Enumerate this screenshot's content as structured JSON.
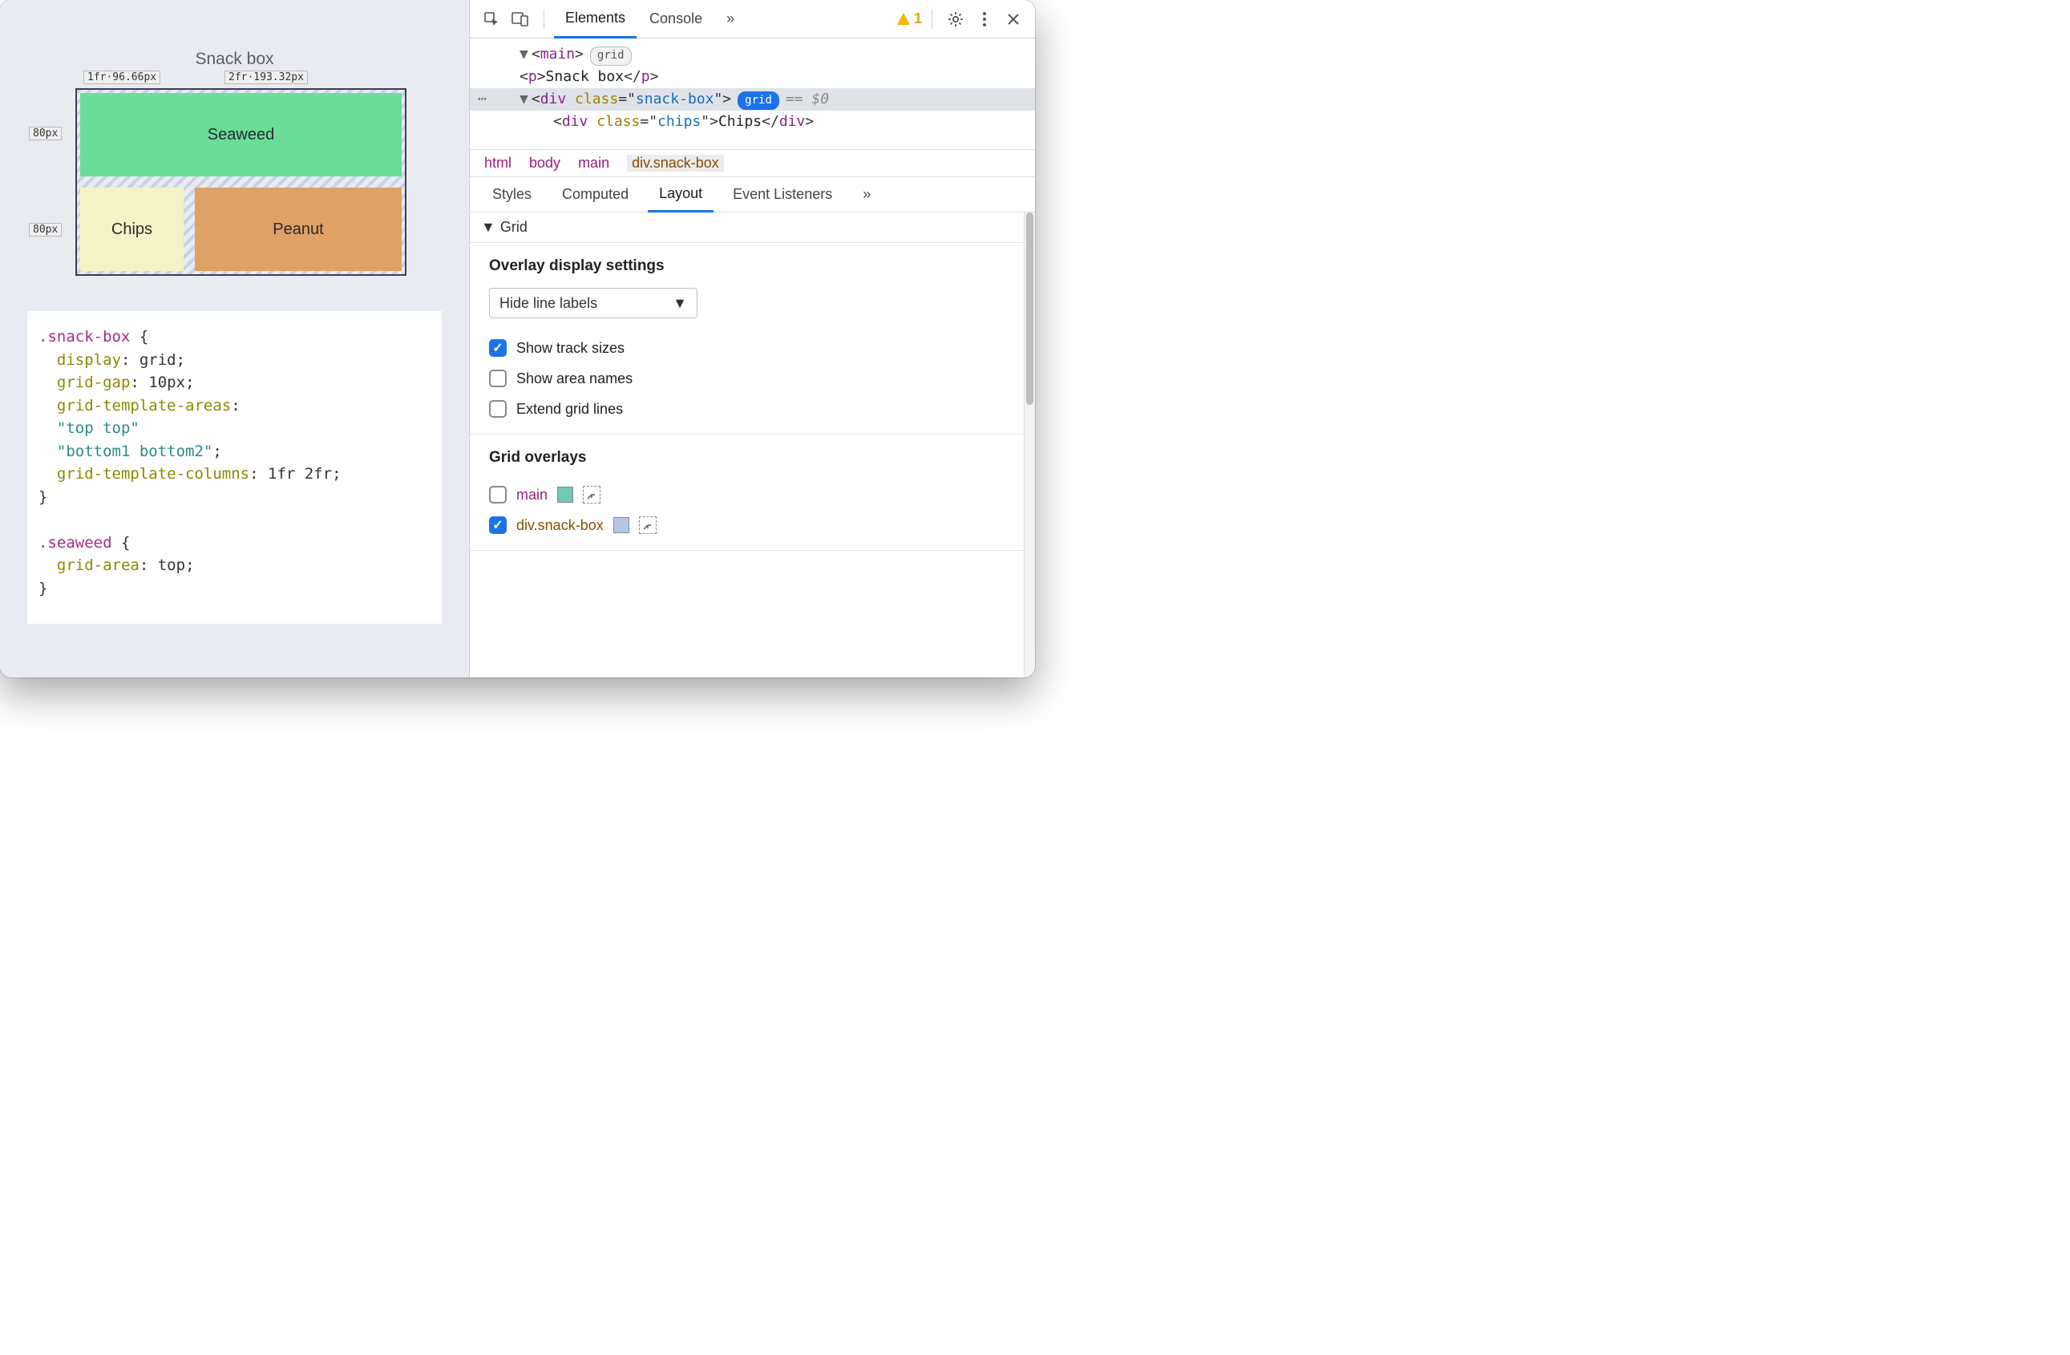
{
  "page": {
    "title": "Snack box",
    "grid": {
      "cells": {
        "seaweed": "Seaweed",
        "chips": "Chips",
        "peanut": "Peanut"
      },
      "measurements": {
        "top_col1": "1fr·96.66px",
        "top_col2": "2fr·193.32px",
        "left_row1": "80px",
        "left_row2": "80px"
      }
    },
    "css_code": {
      "rule1_selector": ".snack-box",
      "rule1_decls": [
        {
          "prop": "display",
          "val": "grid",
          "type": "kw"
        },
        {
          "prop": "grid-gap",
          "val": "10px",
          "type": "kw"
        },
        {
          "prop": "grid-template-areas",
          "val": [
            "\"top top\"",
            "\"bottom1 bottom2\""
          ],
          "type": "strlist"
        },
        {
          "prop": "grid-template-columns",
          "val": "1fr 2fr",
          "type": "kw"
        }
      ],
      "rule2_selector": ".seaweed",
      "rule2_decls": [
        {
          "prop": "grid-area",
          "val": "top",
          "type": "kw"
        }
      ]
    }
  },
  "devtools": {
    "toolbar": {
      "inspect_icon": "inspect",
      "device_icon": "device",
      "tabs": [
        "Elements",
        "Console"
      ],
      "active_tab": "Elements",
      "overflow": "»",
      "warning_count": "1",
      "settings_icon": "gear",
      "menu_icon": "kebab",
      "close_icon": "close"
    },
    "dom": {
      "rows": [
        {
          "depth": 0,
          "open": true,
          "tag": "main",
          "pill": "grid",
          "pill_blue": false
        },
        {
          "depth": 1,
          "tag": "p",
          "text": "Snack box",
          "close": "p"
        },
        {
          "depth": 1,
          "open": true,
          "tag": "div",
          "class": "snack-box",
          "pill": "grid",
          "pill_blue": true,
          "selected": true,
          "suffix": "== $0"
        },
        {
          "depth": 2,
          "tag": "div",
          "class": "chips",
          "text": "Chips",
          "close": "div"
        }
      ]
    },
    "breadcrumb": [
      "html",
      "body",
      "main",
      "div.snack-box"
    ],
    "subtabs": {
      "items": [
        "Styles",
        "Computed",
        "Layout",
        "Event Listeners"
      ],
      "active": "Layout",
      "overflow": "»"
    },
    "layout_panel": {
      "grid_section_label": "Grid",
      "overlay_settings": {
        "heading": "Overlay display settings",
        "select_value": "Hide line labels",
        "options": [
          {
            "label": "Show track sizes",
            "checked": true
          },
          {
            "label": "Show area names",
            "checked": false
          },
          {
            "label": "Extend grid lines",
            "checked": false
          }
        ]
      },
      "grid_overlays": {
        "heading": "Grid overlays",
        "items": [
          {
            "label": "main",
            "checked": false,
            "color": "#6fc9b3"
          },
          {
            "label": "div.snack-box",
            "checked": true,
            "color": "#b6c7ea"
          }
        ]
      }
    }
  }
}
